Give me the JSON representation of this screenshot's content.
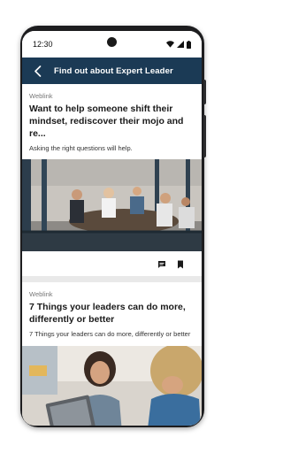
{
  "status_bar": {
    "time": "12:30"
  },
  "app_bar": {
    "title": "Find out about Expert Leader"
  },
  "cards": [
    {
      "type": "Weblink",
      "title": "Want to help someone shift their mindset, rediscover their mojo and re...",
      "description": "Asking the right questions will help."
    },
    {
      "type": "Weblink",
      "title": "7 Things your leaders can do more, differently or better",
      "description": "7 Things your leaders can do more, differently or better"
    }
  ],
  "icons": {
    "back": "arrow-left-icon",
    "comment": "comment-icon",
    "bookmark": "bookmark-icon"
  },
  "colors": {
    "app_bar": "#1b3a55",
    "divider": "#e9e9e9"
  }
}
